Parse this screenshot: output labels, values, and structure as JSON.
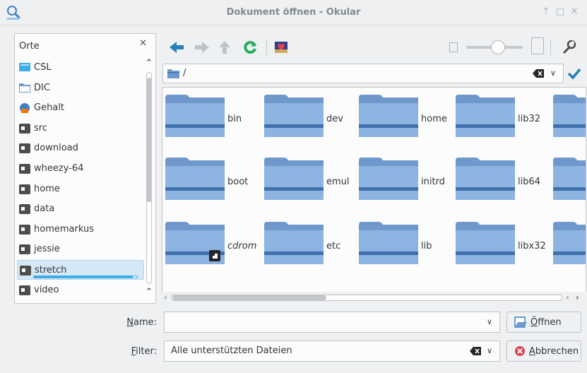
{
  "window": {
    "title": "Dokument öffnen - Okular",
    "controls": [
      "↑",
      "□",
      "✕"
    ]
  },
  "places": {
    "header": "Orte",
    "items": [
      {
        "label": "CSL",
        "icon": "desktop-icon"
      },
      {
        "label": "DIC",
        "icon": "folder-icon"
      },
      {
        "label": "Gehalt",
        "icon": "network-folder-icon"
      },
      {
        "label": "src",
        "icon": "drive-icon"
      },
      {
        "label": "download",
        "icon": "drive-icon"
      },
      {
        "label": "wheezy-64",
        "icon": "drive-icon"
      },
      {
        "label": "home",
        "icon": "drive-icon"
      },
      {
        "label": "data",
        "icon": "drive-icon"
      },
      {
        "label": "homemarkus",
        "icon": "drive-icon"
      },
      {
        "label": "jessie",
        "icon": "drive-icon"
      },
      {
        "label": "stretch",
        "icon": "drive-icon",
        "selected": true,
        "usage_fraction": 0.96
      },
      {
        "label": "video",
        "icon": "drive-icon"
      },
      {
        "label": "",
        "icon": "drive-icon"
      }
    ]
  },
  "location": {
    "path": "/"
  },
  "files": [
    {
      "name": "bin"
    },
    {
      "name": "dev"
    },
    {
      "name": "home"
    },
    {
      "name": "lib32"
    },
    {
      "name": ""
    },
    {
      "name": "boot"
    },
    {
      "name": "emul"
    },
    {
      "name": "initrd"
    },
    {
      "name": "lib64"
    },
    {
      "name": ""
    },
    {
      "name": "cdrom",
      "symlink": true
    },
    {
      "name": "etc"
    },
    {
      "name": "lib"
    },
    {
      "name": "libx32"
    },
    {
      "name": ""
    }
  ],
  "form": {
    "name_label_u": "N",
    "name_label_rest": "ame:",
    "name_value": "",
    "filter_label_u": "F",
    "filter_label_rest": "ilter:",
    "filter_value": "Alle unterstützten Dateien",
    "open_button_u": "Ö",
    "open_button_rest": "ffnen",
    "cancel_button_u": "A",
    "cancel_button_rest": "bbrechen"
  },
  "colors": {
    "folder_body": "#6f98cc",
    "folder_light": "#8db3e0",
    "folder_stripe": "#3f70ac",
    "accent": "#3daee9",
    "cancel_red": "#da4453",
    "reload_green": "#27ae60"
  }
}
